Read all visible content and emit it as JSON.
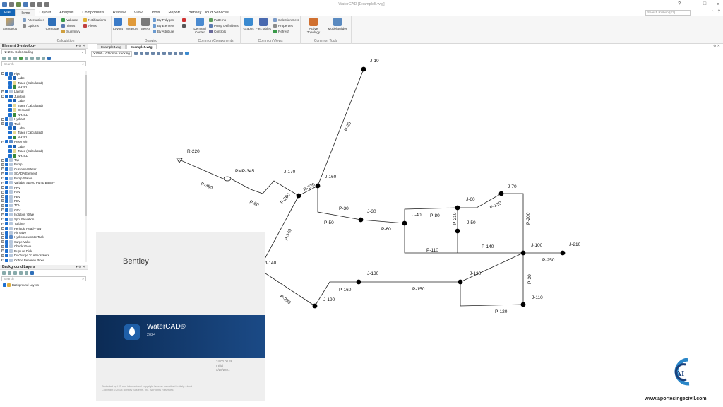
{
  "window": {
    "title": "WaterCAD [Example5.wtg]",
    "controls": [
      "?",
      "–",
      "□",
      "✕"
    ]
  },
  "menu": [
    "File",
    "Home",
    "Layout",
    "Analysis",
    "Components",
    "Review",
    "View",
    "Tools",
    "Report",
    "Bentley Cloud Services"
  ],
  "search_ribbon": "Search Ribbon (F3)",
  "ribbon": {
    "scenarios": "Scenarios",
    "alternatives": "Alternatives",
    "options": "Options",
    "compute": "Compute",
    "validate": "Validate",
    "times": "Times",
    "summary": "Summary",
    "notifications": "Notifications",
    "alerts": "Alerts",
    "calculation": "Calculation",
    "layout": "Layout",
    "measure": "Measure",
    "select": "Select",
    "by_polygon": "By Polygon",
    "by_element": "By Element",
    "by_attribute": "By Attribute",
    "drawing": "Drawing",
    "demand_center": "Demand Center",
    "patterns": "Patterns",
    "pump_definitions": "Pump Definitions",
    "controls": "Controls",
    "common_components": "Common Components",
    "graphs": "Graphs",
    "flextables": "FlexTables",
    "selection_sets": "Selection Sets",
    "properties": "Properties",
    "refresh": "Refresh",
    "common_views": "Common Views",
    "active_topology": "Active Topology",
    "modelbuilder": "ModelBuilder",
    "common_tools": "Common Tools"
  },
  "element_symbology": {
    "title": "Element Symbology",
    "dropdown": "NH2CL Color coding",
    "search": "Search",
    "tree": [
      {
        "label": "Pipe",
        "level": 0,
        "icon": "pipe-icon"
      },
      {
        "label": "Label",
        "level": 1,
        "icon": "label-icon"
      },
      {
        "label": "Trace (Calculated)",
        "level": 1,
        "icon": "trace-icon"
      },
      {
        "label": "NH2CL",
        "level": 1,
        "icon": "color-icon"
      },
      {
        "label": "Lateral",
        "level": 0,
        "icon": "lateral-icon"
      },
      {
        "label": "Junction",
        "level": 0,
        "icon": "junction-icon"
      },
      {
        "label": "Label",
        "level": 1,
        "icon": "label-icon"
      },
      {
        "label": "Trace (Calculated)",
        "level": 1,
        "icon": "trace-icon"
      },
      {
        "label": "Demand",
        "level": 1,
        "icon": "demand-icon"
      },
      {
        "label": "NH2CL",
        "level": 1,
        "icon": "color-icon"
      },
      {
        "label": "Hydrant",
        "level": 0,
        "icon": "hydrant-icon"
      },
      {
        "label": "Tank",
        "level": 0,
        "icon": "tank-icon"
      },
      {
        "label": "Label",
        "level": 1,
        "icon": "label-icon"
      },
      {
        "label": "Trace (Calculated)",
        "level": 1,
        "icon": "trace-icon"
      },
      {
        "label": "NH2CL",
        "level": 1,
        "icon": "color-icon"
      },
      {
        "label": "Reservoir",
        "level": 0,
        "icon": "reservoir-icon"
      },
      {
        "label": "Label",
        "level": 1,
        "icon": "label-icon"
      },
      {
        "label": "Trace (Calculated)",
        "level": 1,
        "icon": "trace-icon"
      },
      {
        "label": "NH2CL",
        "level": 1,
        "icon": "color-icon"
      },
      {
        "label": "Tap",
        "level": 0,
        "icon": "tap-icon"
      },
      {
        "label": "Pump",
        "level": 0,
        "icon": "pump-icon"
      },
      {
        "label": "Customer Meter",
        "level": 0,
        "icon": "meter-icon"
      },
      {
        "label": "SCADA Element",
        "level": 0,
        "icon": "scada-icon"
      },
      {
        "label": "Pump Station",
        "level": 0,
        "icon": "pump-station-icon"
      },
      {
        "label": "Variable Speed Pump Battery",
        "level": 0,
        "icon": "vspb-icon"
      },
      {
        "label": "PRV",
        "level": 0,
        "icon": "valve-icon"
      },
      {
        "label": "PSV",
        "level": 0,
        "icon": "valve-icon"
      },
      {
        "label": "PBV",
        "level": 0,
        "icon": "valve-icon"
      },
      {
        "label": "FCV",
        "level": 0,
        "icon": "valve-icon"
      },
      {
        "label": "TCV",
        "level": 0,
        "icon": "valve-icon"
      },
      {
        "label": "GPV",
        "level": 0,
        "icon": "valve-icon"
      },
      {
        "label": "Isolation Valve",
        "level": 0,
        "icon": "valve-icon"
      },
      {
        "label": "Spot Elevation",
        "level": 0,
        "icon": "spot-icon"
      },
      {
        "label": "Turbine",
        "level": 0,
        "icon": "turbine-icon"
      },
      {
        "label": "Periodic Head-Flow",
        "level": 0,
        "icon": "phf-icon"
      },
      {
        "label": "Air Valve",
        "level": 0,
        "icon": "valve-icon"
      },
      {
        "label": "Hydropneumatic Tank",
        "level": 0,
        "icon": "tank-icon"
      },
      {
        "label": "Surge Valve",
        "level": 0,
        "icon": "valve-icon"
      },
      {
        "label": "Check Valve",
        "level": 0,
        "icon": "valve-icon"
      },
      {
        "label": "Rupture Disk",
        "level": 0,
        "icon": "disk-icon"
      },
      {
        "label": "Discharge To Atmosphere",
        "level": 0,
        "icon": "discharge-icon"
      },
      {
        "label": "Orifice Between Pipes",
        "level": 0,
        "icon": "orifice-icon"
      }
    ]
  },
  "background_layers": {
    "title": "Background Layers",
    "search": "Search",
    "item": "Background Layers"
  },
  "doc_tabs": [
    "Example4.wtg",
    "Example5.wtg"
  ],
  "scenario_select": "Y2000 - Chlorine tracking",
  "network": {
    "labels": [
      "J-10",
      "P-20",
      "R-220",
      "P-350",
      "PMP-345",
      "J-170",
      "J-160",
      "P-80",
      "P-260",
      "R-220",
      "P-30",
      "J-30",
      "J-40",
      "P-80",
      "J-60",
      "J-70",
      "P-310",
      "P-200",
      "P-210",
      "J-50",
      "P-50",
      "P-60",
      "P-340",
      "P-110",
      "P-140",
      "J-100",
      "J-210",
      "P-250",
      "J-140",
      "J-130",
      "J-120",
      "P-30",
      "P-160",
      "P-150",
      "P-230",
      "J-190",
      "J-110",
      "P-120"
    ]
  },
  "splash": {
    "brand": "Bentley",
    "product": "WaterCAD®",
    "year": "2024",
    "version": "24.00.00.36",
    "version_note": "Initial",
    "date": "3/28/2024",
    "copyright1": "Protected by US and international copyright laws as described in Help About.",
    "copyright2": "Copyright © 2024 Bentley Systems, Inc. All Rights Reserved."
  },
  "watermark": {
    "text": "www.aportesingecivil.com",
    "monogram": "AI"
  },
  "colors": {
    "file_tab": "#1465b5",
    "checkbox": "#1e6fcf",
    "splash_band": "#0b2b55"
  }
}
